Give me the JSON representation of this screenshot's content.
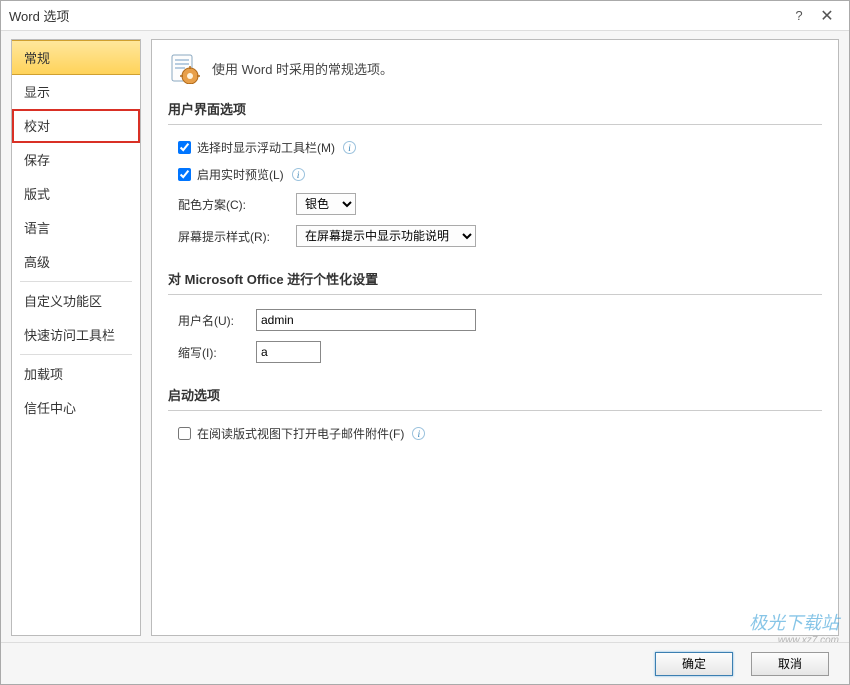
{
  "title": "Word 选项",
  "titlebar": {
    "help_icon": "?",
    "close_icon": "✕"
  },
  "sidebar": {
    "items": [
      {
        "label": "常规",
        "selected": true,
        "highlighted": false
      },
      {
        "label": "显示",
        "selected": false,
        "highlighted": false
      },
      {
        "label": "校对",
        "selected": false,
        "highlighted": true
      },
      {
        "label": "保存",
        "selected": false,
        "highlighted": false
      },
      {
        "label": "版式",
        "selected": false,
        "highlighted": false
      },
      {
        "label": "语言",
        "selected": false,
        "highlighted": false
      },
      {
        "label": "高级",
        "selected": false,
        "highlighted": false
      },
      {
        "label": "自定义功能区",
        "selected": false,
        "highlighted": false,
        "sep_before": true
      },
      {
        "label": "快速访问工具栏",
        "selected": false,
        "highlighted": false
      },
      {
        "label": "加载项",
        "selected": false,
        "highlighted": false,
        "sep_before": true
      },
      {
        "label": "信任中心",
        "selected": false,
        "highlighted": false
      }
    ]
  },
  "intro": {
    "text": "使用 Word 时采用的常规选项。"
  },
  "section_ui": {
    "title": "用户界面选项",
    "floating_toolbar": {
      "label": "选择时显示浮动工具栏(M)",
      "checked": true
    },
    "live_preview": {
      "label": "启用实时预览(L)",
      "checked": true
    },
    "color_scheme": {
      "label": "配色方案(C):",
      "value": "银色"
    },
    "screentip_style": {
      "label": "屏幕提示样式(R):",
      "value": "在屏幕提示中显示功能说明"
    }
  },
  "section_personalize": {
    "title": "对 Microsoft Office 进行个性化设置",
    "username": {
      "label": "用户名(U):",
      "value": "admin"
    },
    "initials": {
      "label": "缩写(I):",
      "value": "a"
    }
  },
  "section_startup": {
    "title": "启动选项",
    "open_attachment": {
      "label": "在阅读版式视图下打开电子邮件附件(F)",
      "checked": false
    }
  },
  "footer": {
    "ok": "确定",
    "cancel": "取消"
  },
  "watermark": {
    "text": "极光下载站",
    "url": "www.xz7.com"
  }
}
